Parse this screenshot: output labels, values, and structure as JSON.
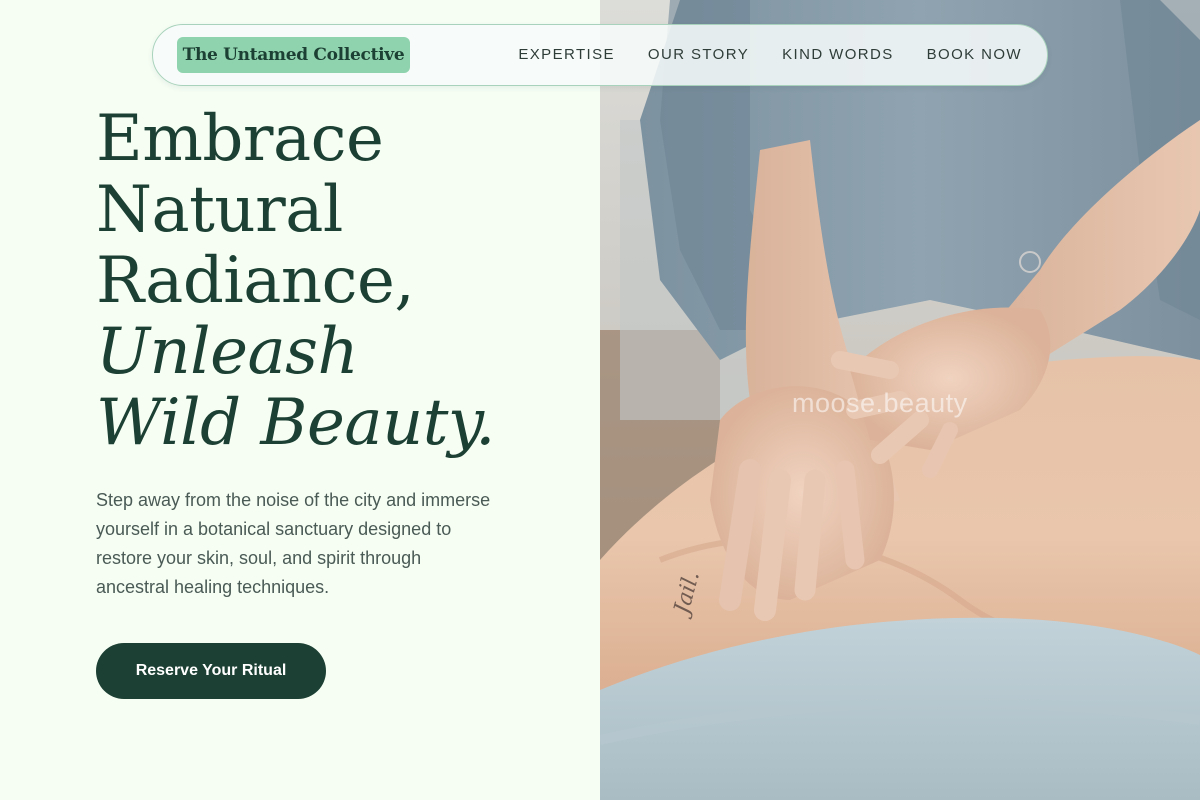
{
  "brand": {
    "name": "The Untamed Collective"
  },
  "nav": {
    "items": [
      {
        "label": "EXPERTISE"
      },
      {
        "label": "OUR STORY"
      },
      {
        "label": "KIND WORDS"
      },
      {
        "label": "BOOK NOW"
      }
    ]
  },
  "hero": {
    "headline_lines": [
      "Embrace",
      "Natural",
      "Radiance,"
    ],
    "headline_italic_lines": [
      "Unleash",
      "Wild Beauty."
    ],
    "description": "Step away from the noise of the city and immerse yourself in a botanical sanctuary designed to restore your skin, soul, and spirit through ancestral healing techniques.",
    "cta_label": "Reserve Your Ritual"
  },
  "photo": {
    "watermark": "moose.beauty",
    "wrist_tattoo": "Jail."
  },
  "colors": {
    "background": "#f6fef4",
    "primary_dark_green": "#1c4033",
    "logo_badge_green": "#8fd3ae",
    "nav_border": "#a8d2bc",
    "body_text": "#4a5a55"
  }
}
